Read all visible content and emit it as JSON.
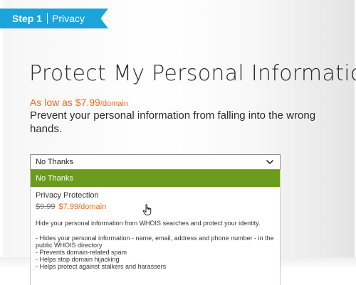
{
  "step": {
    "number_label": "Step 1",
    "name": "Privacy",
    "color": "#1aa4d8"
  },
  "heading": "Protect My Personal Information",
  "price": {
    "prefix": "As low as $7.99",
    "suffix": "/domain",
    "color": "#f26b1d"
  },
  "description": "Prevent your personal information from falling into the wrong hands.",
  "select": {
    "value": "No Thanks",
    "icon": "chevron-down-icon"
  },
  "dropdown": {
    "selected_option": "No Thanks",
    "selected_color": "#6b9b1c",
    "privacy_option": {
      "title": "Privacy Protection",
      "old_price": "$9.99",
      "new_price": "$7.99/domain",
      "info": "Hide your personal information from WHOIS searches and protect your identity.",
      "bullets": [
        "- Hides your personal information - name, email, address and phone number - in the public WHOIS directory",
        "- Prevents domain-related spam",
        "- Helps stop domain hijacking",
        "- Helps protect against stalkers and harassers"
      ]
    }
  },
  "cursor": "hand-pointer-icon"
}
